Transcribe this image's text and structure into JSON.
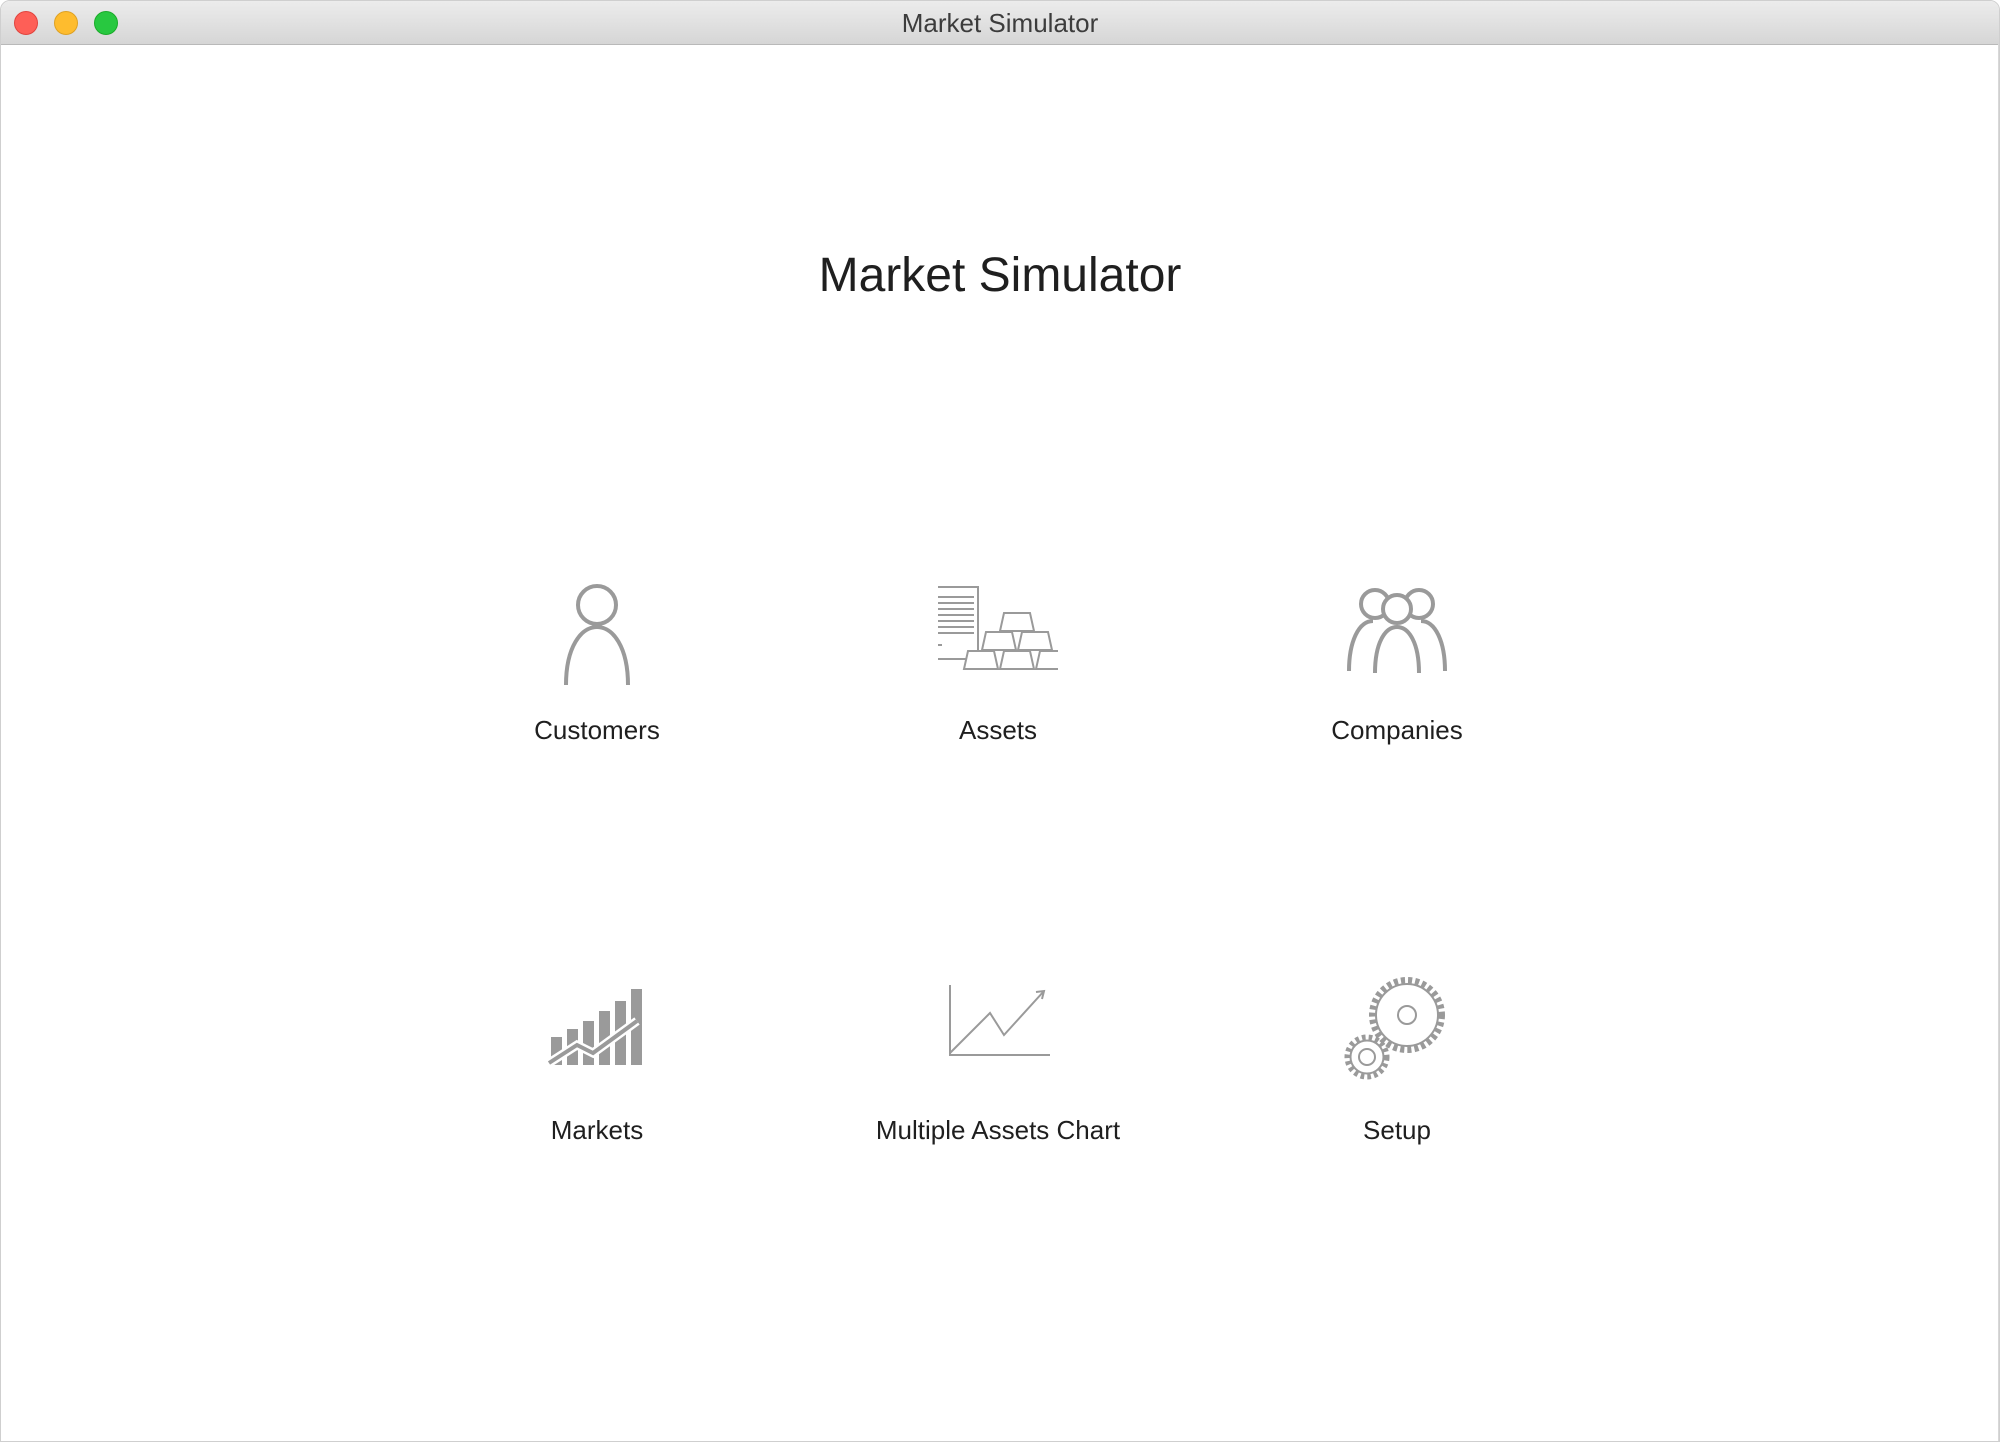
{
  "window": {
    "title": "Market Simulator"
  },
  "main": {
    "title": "Market Simulator"
  },
  "tiles": [
    {
      "label": "Customers",
      "icon": "person-icon"
    },
    {
      "label": "Assets",
      "icon": "assets-gold-bars-icon"
    },
    {
      "label": "Companies",
      "icon": "group-people-icon"
    },
    {
      "label": "Markets",
      "icon": "bar-chart-trend-icon"
    },
    {
      "label": "Multiple Assets Chart",
      "icon": "line-chart-icon"
    },
    {
      "label": "Setup",
      "icon": "gears-icon"
    }
  ],
  "colors": {
    "icon": "#9a9a9a",
    "text": "#1f1f1f",
    "close": "#fe5f57",
    "minimize": "#febc2e",
    "zoom": "#28c840"
  }
}
